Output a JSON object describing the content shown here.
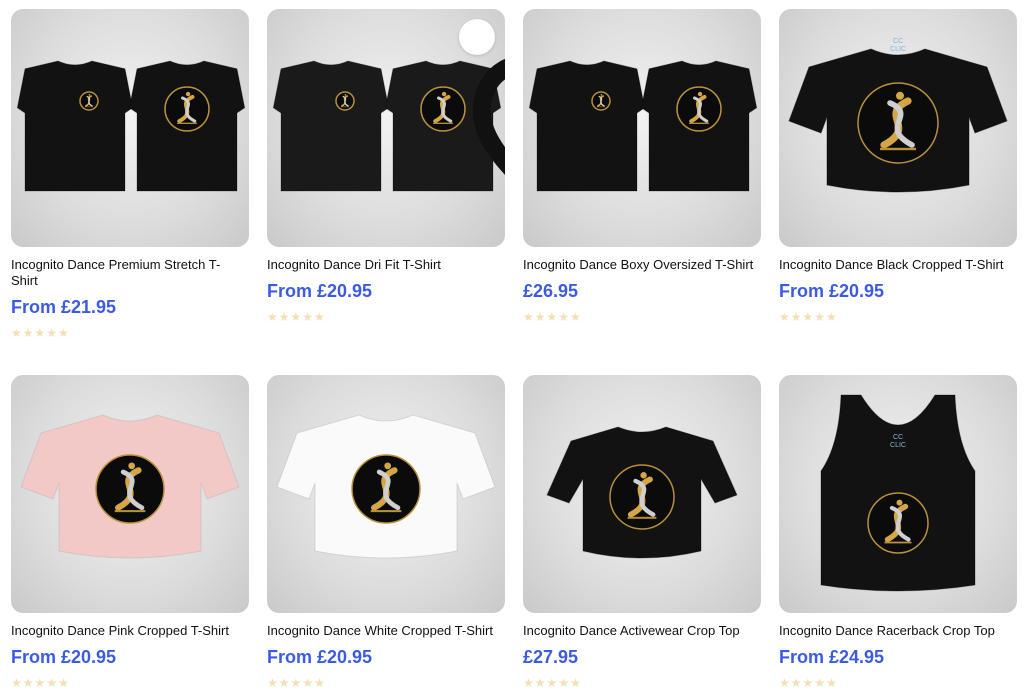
{
  "products": [
    {
      "title": "Incognito Dance Premium Stretch T-Shirt",
      "price": "From £21.95",
      "rating": "★★★★★",
      "garment": "tee-pair",
      "color": "#121212"
    },
    {
      "title": "Incognito Dance Dri Fit T-Shirt",
      "price": "From £20.95",
      "rating": "★★★★★",
      "garment": "tee-pair",
      "color": "#1a1a1a",
      "favorite_icon": "heart-icon"
    },
    {
      "title": "Incognito Dance Boxy Oversized T-Shirt",
      "price": "£26.95",
      "rating": "★★★★★",
      "garment": "tee-pair",
      "color": "#121212"
    },
    {
      "title": "Incognito Dance Black Cropped T-Shirt",
      "price": "From £20.95",
      "rating": "★★★★★",
      "garment": "crop",
      "color": "#121212",
      "print_text": "CC CLIC"
    },
    {
      "title": "Incognito Dance Pink Cropped T-Shirt",
      "price": "From £20.95",
      "rating": "★★★★★",
      "garment": "crop",
      "color": "#f2c9c6"
    },
    {
      "title": "Incognito Dance White Cropped T-Shirt",
      "price": "From £20.95",
      "rating": "★★★★★",
      "garment": "crop",
      "color": "#fafafa"
    },
    {
      "title": "Incognito Dance Activewear Crop Top",
      "price": "£27.95",
      "rating": "★★★★★",
      "garment": "active-crop",
      "color": "#121212"
    },
    {
      "title": "Incognito Dance Racerback Crop Top",
      "price": "From £24.95",
      "rating": "★★★★★",
      "garment": "racerback",
      "color": "#121212",
      "print_text": "CC CLIC"
    }
  ]
}
